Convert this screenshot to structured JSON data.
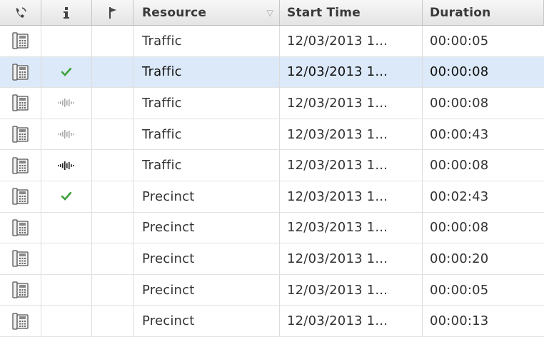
{
  "columns": {
    "type_icon": "phone-icon",
    "info_icon": "info-icon",
    "flag_icon": "flag-icon",
    "resource": "Resource",
    "start_time": "Start Time",
    "duration": "Duration"
  },
  "rows": [
    {
      "resource": "Traffic",
      "start_time": "12/03/2013 1...",
      "duration": "00:00:05",
      "status": "none",
      "selected": false
    },
    {
      "resource": "Traffic",
      "start_time": "12/03/2013 1...",
      "duration": "00:00:08",
      "status": "check",
      "selected": true
    },
    {
      "resource": "Traffic",
      "start_time": "12/03/2013 1...",
      "duration": "00:00:08",
      "status": "audio-light",
      "selected": false
    },
    {
      "resource": "Traffic",
      "start_time": "12/03/2013 1...",
      "duration": "00:00:43",
      "status": "audio-light",
      "selected": false
    },
    {
      "resource": "Traffic",
      "start_time": "12/03/2013 1...",
      "duration": "00:00:08",
      "status": "audio-dark",
      "selected": false
    },
    {
      "resource": "Precinct",
      "start_time": "12/03/2013 1...",
      "duration": "00:02:43",
      "status": "check",
      "selected": false
    },
    {
      "resource": "Precinct",
      "start_time": "12/03/2013 1...",
      "duration": "00:00:08",
      "status": "none",
      "selected": false
    },
    {
      "resource": "Precinct",
      "start_time": "12/03/2013 1...",
      "duration": "00:00:20",
      "status": "none",
      "selected": false
    },
    {
      "resource": "Precinct",
      "start_time": "12/03/2013 1...",
      "duration": "00:00:05",
      "status": "none",
      "selected": false
    },
    {
      "resource": "Precinct",
      "start_time": "12/03/2013 1...",
      "duration": "00:00:13",
      "status": "none",
      "selected": false
    }
  ],
  "colors": {
    "selected_row": "#dce9f8",
    "check": "#3aa13a",
    "audio_light": "#a9a9a9",
    "audio_dark": "#222222"
  }
}
